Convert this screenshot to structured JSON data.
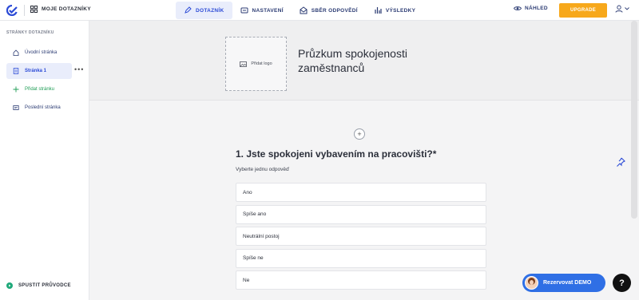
{
  "topbar": {
    "my_surveys": "MOJE DOTAZNÍKY",
    "nav": [
      {
        "label": "DOTAZNÍK",
        "icon": "pencil-icon",
        "active": true
      },
      {
        "label": "NASTAVENÍ",
        "icon": "settings-icon",
        "active": false
      },
      {
        "label": "SBĚR ODPOVĚDÍ",
        "icon": "mail-icon",
        "active": false
      },
      {
        "label": "VÝSLEDKY",
        "icon": "bar-chart-icon",
        "active": false
      }
    ],
    "preview_label": "NÁHLED",
    "upgrade_label": "UPGRADE",
    "accent_color": "#f7a81b"
  },
  "sidebar": {
    "heading": "STRÁNKY DOTAZNÍKU",
    "items": [
      {
        "label": "Úvodní stránka",
        "icon": "home-icon"
      },
      {
        "label": "Stránka 1",
        "icon": "page-icon",
        "active": true
      },
      {
        "label": "Přidat stránku",
        "icon": "plus-icon"
      },
      {
        "label": "Poslední stránka",
        "icon": "flag-icon"
      }
    ],
    "more_label": "•••",
    "guide_label": "SPUSTIT PRŮVODCE"
  },
  "header": {
    "logo_placeholder": "Přidat logo",
    "survey_title": "Průzkum spokojenosti zaměstnanců"
  },
  "question": {
    "title": "1. Jste spokojeni vybavením na pracovišti?*",
    "subtitle": "Vyberte jednu odpověď",
    "options": [
      "Ano",
      "Spíše ano",
      "Neutrální postoj",
      "Spíše ne",
      "Ne"
    ]
  },
  "add_symbol": "+",
  "demo_button": "Rezervovat DEMO",
  "help_button": "?"
}
